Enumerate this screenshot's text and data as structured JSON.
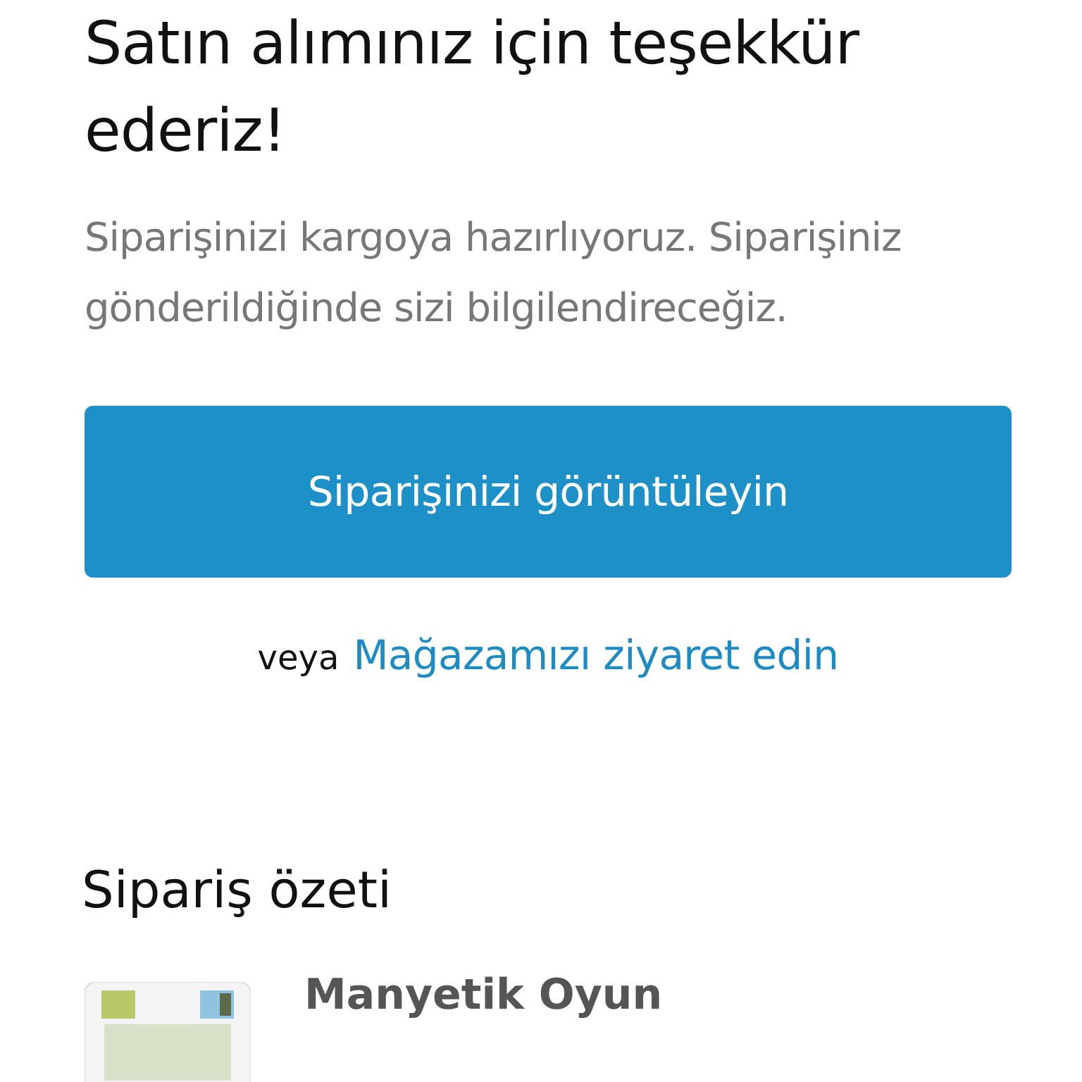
{
  "title": "Satın alımınız için teşekkür ederiz!",
  "message": "Siparişinizi kargoya hazırlıyoruz. Siparişiniz gönderildiğinde sizi bilgilendireceğiz.",
  "view_order_button": "Siparişinizi görüntüleyin",
  "alternative": {
    "prefix": "veya",
    "link": "Mağazamızı ziyaret edin"
  },
  "summary": {
    "heading": "Sipariş özeti",
    "items": [
      {
        "kind": "picture",
        "name": "Manyetik Oyun"
      }
    ]
  }
}
